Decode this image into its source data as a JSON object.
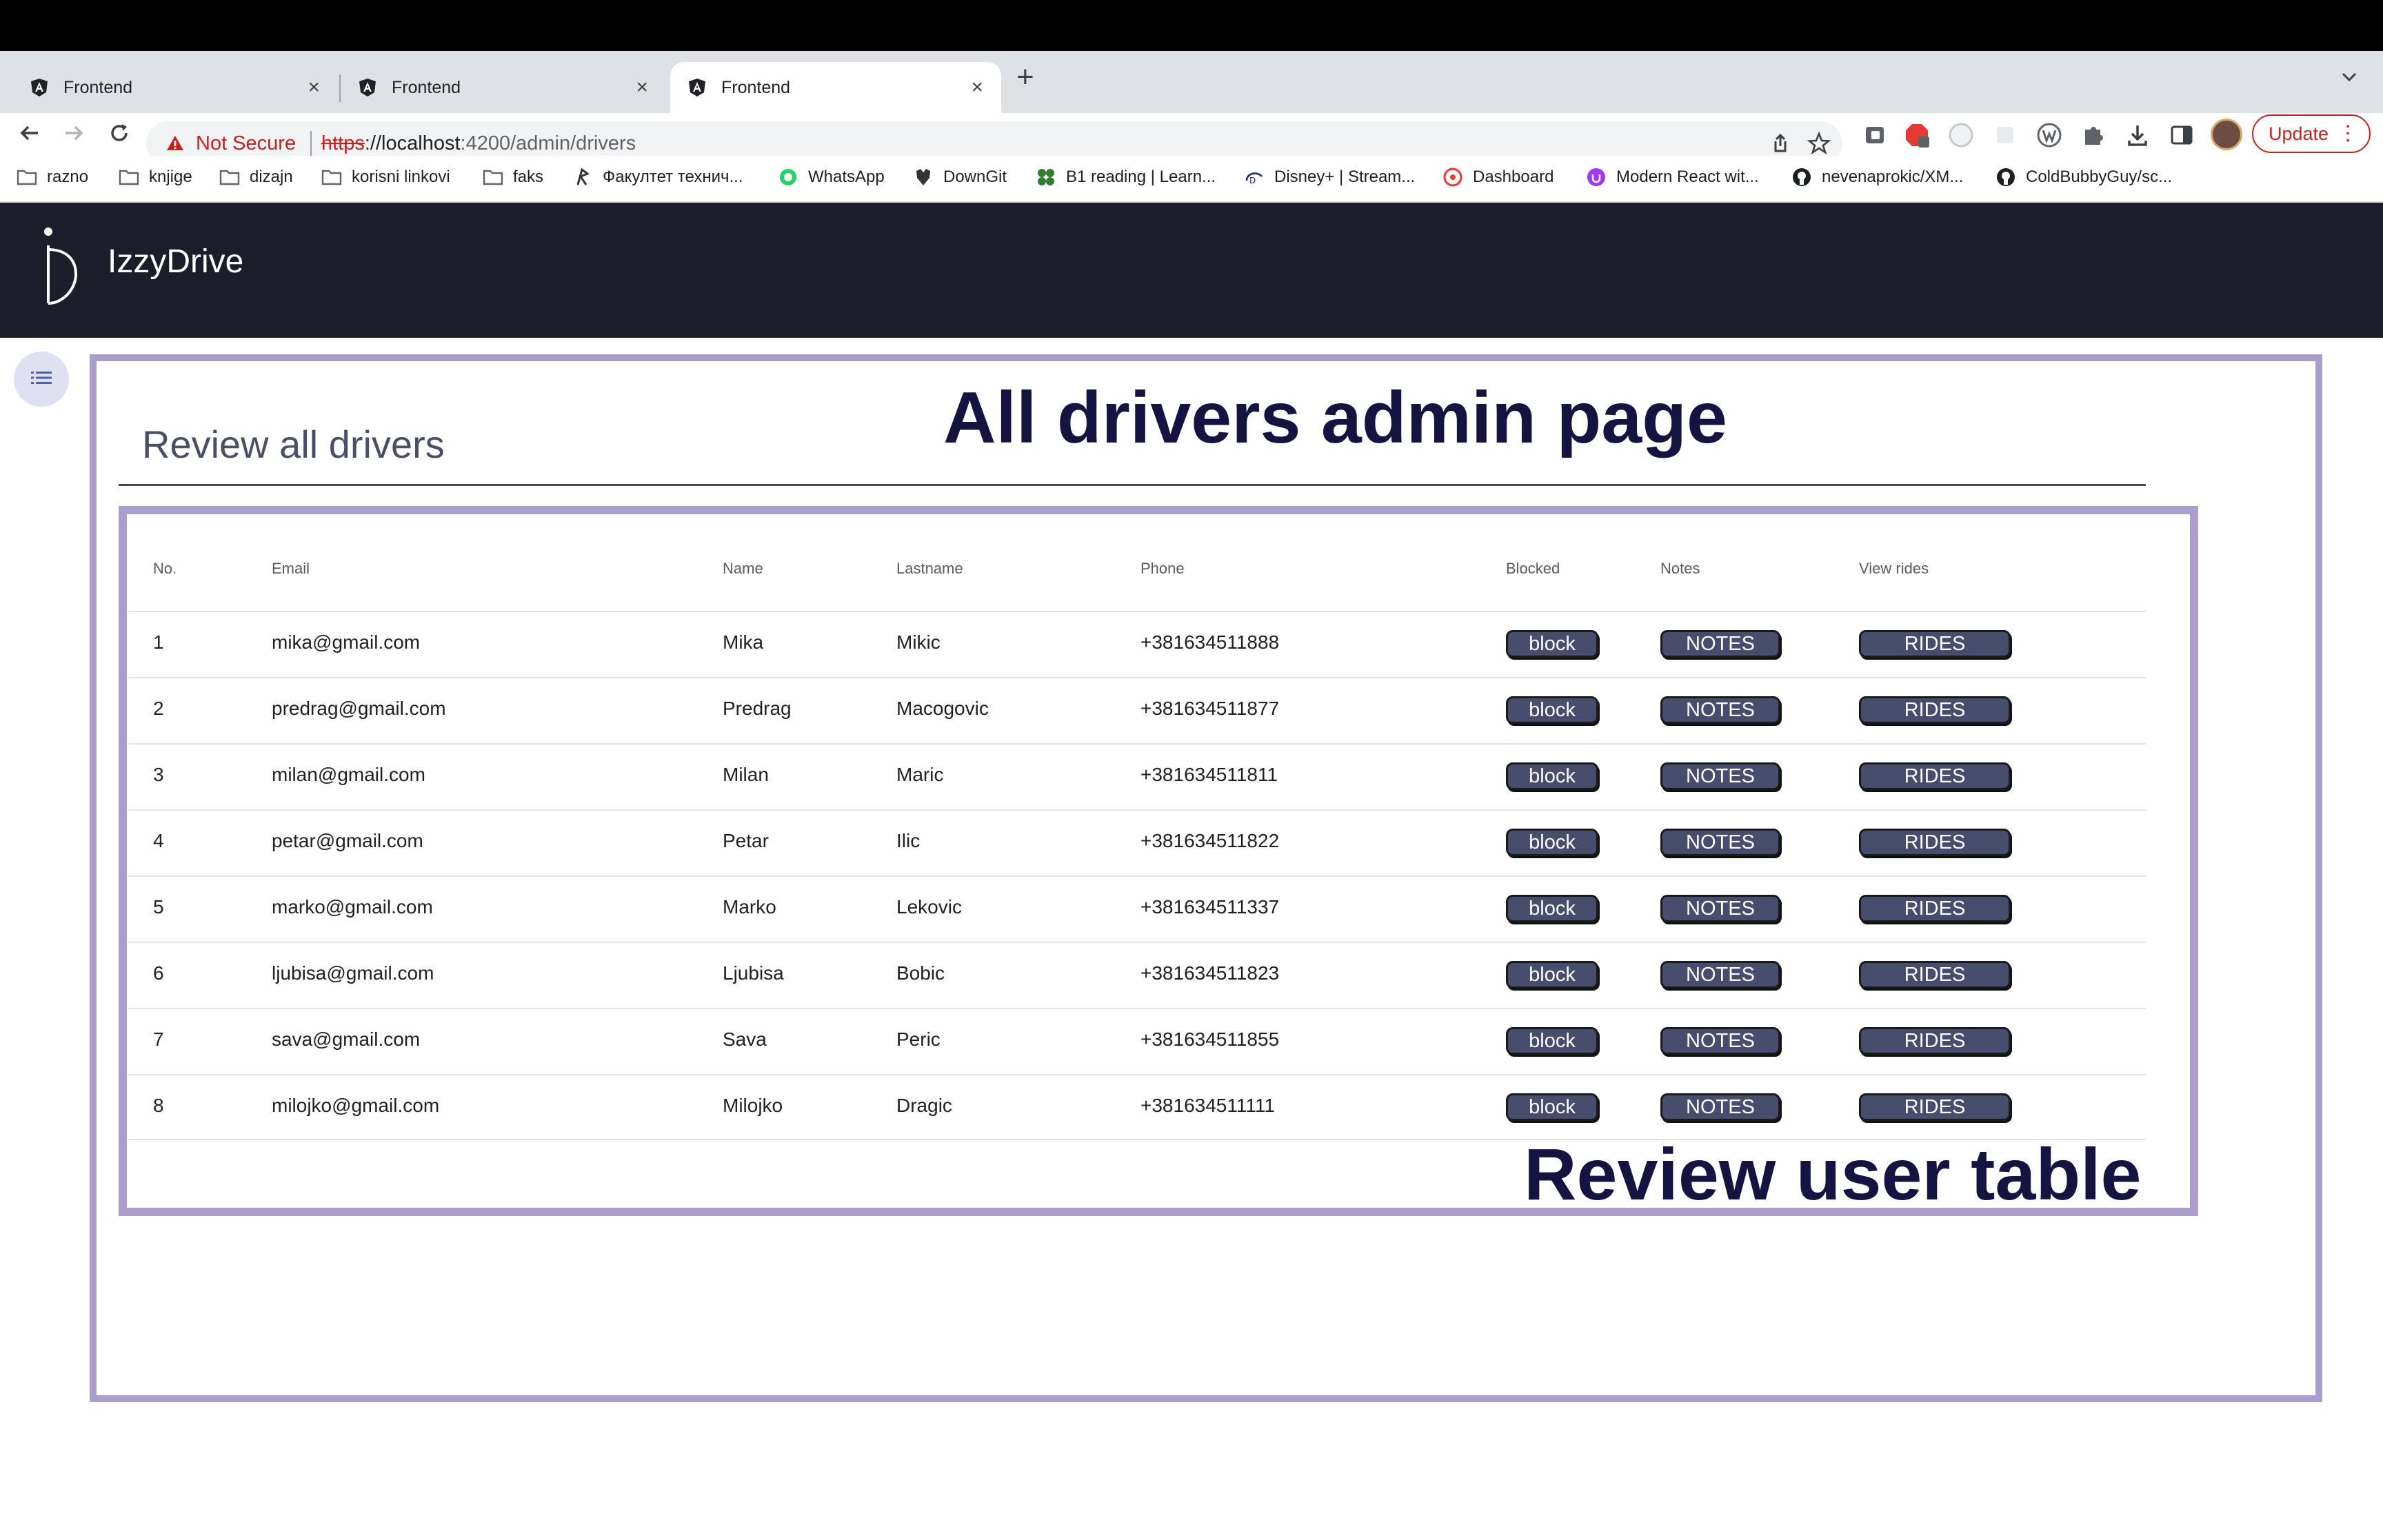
{
  "browser": {
    "tabs": [
      {
        "title": "Frontend",
        "active": false
      },
      {
        "title": "Frontend",
        "active": false
      },
      {
        "title": "Frontend",
        "active": true
      }
    ],
    "tab_close": "×",
    "new_tab": "+",
    "address": {
      "security": "Not Secure",
      "scheme": "https",
      "host": "://localhost",
      "path": ":4200/admin/drivers"
    },
    "update_label": "Update",
    "update_dots": "⋮",
    "bookmarks": [
      {
        "label": "razno",
        "icon": "folder-icon"
      },
      {
        "label": "knjige",
        "icon": "folder-icon"
      },
      {
        "label": "dizajn",
        "icon": "folder-icon"
      },
      {
        "label": "korisni linkovi",
        "icon": "folder-icon"
      },
      {
        "label": "faks",
        "icon": "folder-icon"
      },
      {
        "label": "Факултет технич...",
        "icon": "ftn-icon"
      },
      {
        "label": "WhatsApp",
        "icon": "whatsapp-icon"
      },
      {
        "label": "DownGit",
        "icon": "downgit-icon"
      },
      {
        "label": "B1 reading | Learn...",
        "icon": "clover-icon"
      },
      {
        "label": "Disney+ | Stream...",
        "icon": "disney-icon"
      },
      {
        "label": "Dashboard",
        "icon": "dashboard-icon"
      },
      {
        "label": "Modern React wit...",
        "icon": "udemy-icon"
      },
      {
        "label": "nevenaprokic/XM...",
        "icon": "github-icon"
      },
      {
        "label": "ColdBubbyGuy/sc...",
        "icon": "github-icon"
      }
    ]
  },
  "app": {
    "name": "IzzyDrive",
    "page_title": "Review all drivers",
    "annotation_page": "All drivers admin page",
    "annotation_table": "Review user table"
  },
  "table": {
    "headers": [
      "No.",
      "Email",
      "Name",
      "Lastname",
      "Phone",
      "Blocked",
      "Notes",
      "View rides"
    ],
    "rows": [
      {
        "no": "1",
        "email": "mika@gmail.com",
        "name": "Mika",
        "lastname": "Mikic",
        "phone": "+381634511888",
        "block": "block",
        "notes": "NOTES",
        "rides": "RIDES"
      },
      {
        "no": "2",
        "email": "predrag@gmail.com",
        "name": "Predrag",
        "lastname": "Macogovic",
        "phone": "+381634511877",
        "block": "block",
        "notes": "NOTES",
        "rides": "RIDES"
      },
      {
        "no": "3",
        "email": "milan@gmail.com",
        "name": "Milan",
        "lastname": "Maric",
        "phone": "+381634511811",
        "block": "block",
        "notes": "NOTES",
        "rides": "RIDES"
      },
      {
        "no": "4",
        "email": "petar@gmail.com",
        "name": "Petar",
        "lastname": "Ilic",
        "phone": "+381634511822",
        "block": "block",
        "notes": "NOTES",
        "rides": "RIDES"
      },
      {
        "no": "5",
        "email": "marko@gmail.com",
        "name": "Marko",
        "lastname": "Lekovic",
        "phone": "+381634511337",
        "block": "block",
        "notes": "NOTES",
        "rides": "RIDES"
      },
      {
        "no": "6",
        "email": "ljubisa@gmail.com",
        "name": "Ljubisa",
        "lastname": "Bobic",
        "phone": "+381634511823",
        "block": "block",
        "notes": "NOTES",
        "rides": "RIDES"
      },
      {
        "no": "7",
        "email": "sava@gmail.com",
        "name": "Sava",
        "lastname": "Peric",
        "phone": "+381634511855",
        "block": "block",
        "notes": "NOTES",
        "rides": "RIDES"
      },
      {
        "no": "8",
        "email": "milojko@gmail.com",
        "name": "Milojko",
        "lastname": "Dragic",
        "phone": "+381634511111",
        "block": "block",
        "notes": "NOTES",
        "rides": "RIDES"
      }
    ]
  },
  "colors": {
    "header_bg": "#1b1d2a",
    "frame": "#a99ecc",
    "button_bg": "#474e6d",
    "annotation": "#15133f"
  }
}
